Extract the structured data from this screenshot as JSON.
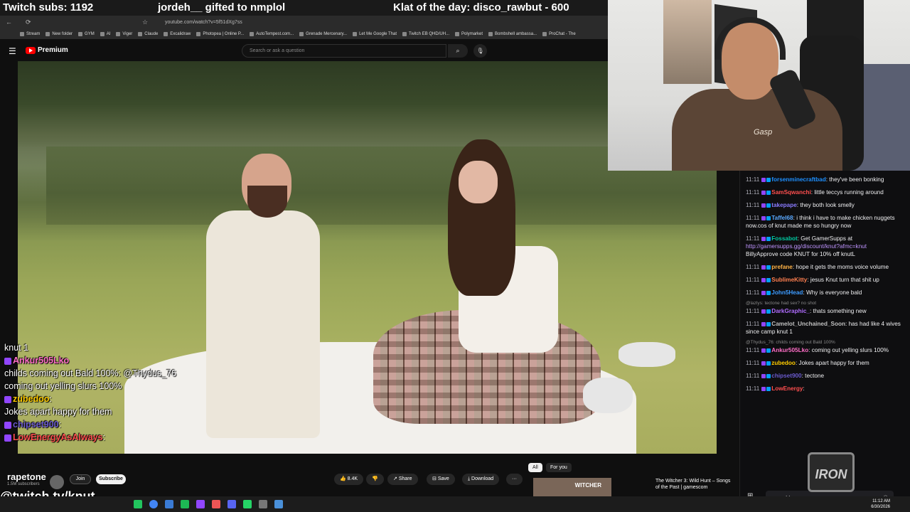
{
  "overlay": {
    "subs": "Twitch subs: 1192",
    "gift": "jordeh__ gifted to nmplol",
    "klat": "Klat of the day: disco_rawbut - 600"
  },
  "browser": {
    "url": "youtube.com/watch?v=5f51dXg7ss",
    "bookmarks": [
      "Stream",
      "New folder",
      "GYM",
      "AI",
      "Viger",
      "Claude",
      "Excalidraw",
      "Photopea | Online P...",
      "AutoTempest.com...",
      "Grenade Mercenary...",
      "Let Me Google That",
      "Twitch EB QHD/UH...",
      "Polymarket",
      "Bombshell ambassa...",
      "ProChat - The"
    ]
  },
  "youtube": {
    "logo": "Premium",
    "search_placeholder": "Search or ask a question",
    "channel_name": "rapetone",
    "subscribers": "1.5M subscribers",
    "join": "Join",
    "subscribe": "Subscribe",
    "likes": "8.4K",
    "share": "Share",
    "save": "Save",
    "download": "Download",
    "more": "···",
    "pills": [
      "All",
      "For you"
    ],
    "rec_title": "The Witcher 3: Wild Hunt – Songs of the Past | gamescom",
    "rec_thumb_label": "WITCHER"
  },
  "left_chat": [
    {
      "name": "",
      "text": "knut 1"
    },
    {
      "name": "Ankur505Lko",
      "text": ""
    },
    {
      "name": "",
      "text": "childs coming out Bald 100%:  @Thydus_76"
    },
    {
      "name": "",
      "text": "coming out yelling slurs 100%"
    },
    {
      "name": "zubedoo",
      "text": ":"
    },
    {
      "name": "",
      "text": "Jokes apart happy for them"
    },
    {
      "name": "chipset900",
      "text": ":"
    },
    {
      "name": "LowEnergyAsAlways",
      "text": ":"
    }
  ],
  "chat": [
    {
      "time": "11:11",
      "user": "forsenminecraftbad",
      "color": "#1e90ff",
      "text": "they've been bonking"
    },
    {
      "time": "11:11",
      "user": "SamSqwanchi",
      "color": "#ff4f4f",
      "text": "little teccys running around"
    },
    {
      "time": "11:11",
      "user": "takepape",
      "color": "#8a7bff",
      "text": "they both look smelly"
    },
    {
      "time": "11:11",
      "user": "Taffel68",
      "color": "#5ba9ff",
      "text": "i think i have to make chicken nuggets now.cos of knut made me so hungry now"
    },
    {
      "time": "11:11",
      "user": "Fossabot",
      "color": "#00c8a0",
      "text": "Get GamerSupps at",
      "link": "http://gamersupps.gg/discount/knut?afmc=knut",
      "extra": "BillyApprove code KNUT for 10% off knutL"
    },
    {
      "time": "11:11",
      "user": "prefane",
      "color": "#ffb347",
      "text": "hope it gets the moms voice volume"
    },
    {
      "time": "11:11",
      "user": "SublimeKitty",
      "color": "#ff7f50",
      "text": "jesus Knut turn that shit up"
    },
    {
      "time": "11:11",
      "user": "John5Head",
      "color": "#3d9bff",
      "text": "Why is everyone bald"
    },
    {
      "reply": "@lazlys: tectone had sex? no shot",
      "time": "11:11",
      "user": "DarkGraphic_",
      "color": "#b06cff",
      "text": "thats something new"
    },
    {
      "time": "11:11",
      "user": "Camelot_Unchained_Soon",
      "color": "#c0c0c0",
      "text": "has had like 4 wives",
      "extra": "since camp knut 1"
    },
    {
      "reply": "@Thydus_76: childs coming out Bald 100%",
      "time": "11:11",
      "user": "Ankur505Lko",
      "color": "#ff6ec7",
      "text": "coming out yelling slurs 100%"
    },
    {
      "time": "11:11",
      "user": "zubedoo",
      "color": "#ffcc00",
      "text": "Jokes apart happy for them"
    },
    {
      "time": "11:11",
      "user": "chipset900",
      "color": "#6a5acd",
      "text": "tectone"
    },
    {
      "time": "11:11",
      "user": "LowEnergy",
      "color": "#ff4f4f",
      "text": ""
    }
  ],
  "chat_input": "Message",
  "twitch_url": "@twitch.tv/knut",
  "watermark": "IRON",
  "clock": {
    "time": "11:12 AM",
    "date": "6/30/2026"
  },
  "colors": {
    "yt_red": "#ff0000",
    "twitch_purple": "#9146ff",
    "bg": "#0f0f0f"
  },
  "icons": [
    "menu-icon",
    "search-icon",
    "mic-icon",
    "like-icon",
    "dislike-icon",
    "share-icon",
    "save-icon",
    "download-icon",
    "grid-icon",
    "emote-icon"
  ]
}
